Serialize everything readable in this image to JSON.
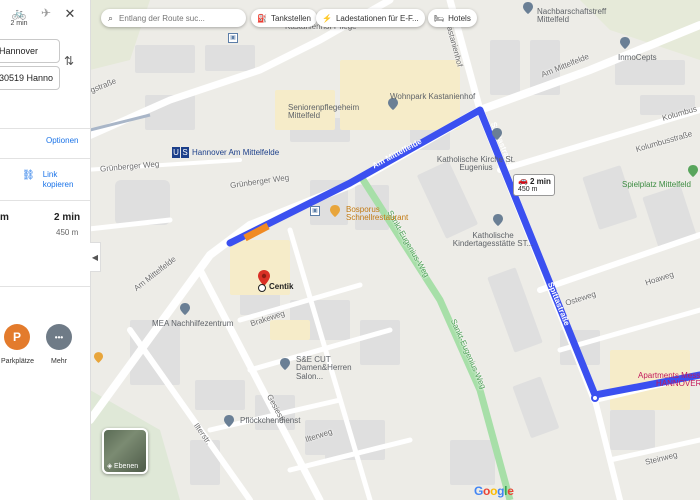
{
  "panel": {
    "modes": [
      {
        "icon": "bicycle-icon",
        "glyph": "🚲",
        "caption": "2 min"
      },
      {
        "icon": "airplane-icon",
        "glyph": "✈",
        "caption": ""
      },
      {
        "icon": "close-icon",
        "glyph": "✕",
        "caption": ""
      }
    ],
    "origin_value": "Hannover",
    "destination_value": "30519 Hanno",
    "options_label": "Optionen",
    "link_label": "Link kopieren",
    "route_duration": "2 min",
    "route_duration_left": "m",
    "route_distance": "450 m",
    "nearby": [
      {
        "icon": "parking-icon",
        "glyph": "P",
        "label": "Parkplätze",
        "color": "#e37b2c"
      },
      {
        "icon": "more-icon",
        "glyph": "•••",
        "label": "Mehr",
        "color": "#6f7b87"
      }
    ]
  },
  "map_controls": {
    "search_placeholder": "Entlang der Route suc...",
    "chips": [
      {
        "icon": "gas-station-icon",
        "glyph": "⛽",
        "label": "Tankstellen"
      },
      {
        "icon": "ev-charging-icon",
        "glyph": "⚡",
        "label": "Ladestationen für E-F..."
      },
      {
        "icon": "hotel-icon",
        "glyph": "🛏",
        "label": "Hotels"
      }
    ],
    "callout_duration": "2 min",
    "callout_distance": "450 m",
    "layers_label": "Ebenen",
    "attribution": "Google"
  },
  "map": {
    "route_color": "#3b50f0",
    "streets": [
      {
        "text": "Am Mittelfelde",
        "name": "street-am-mittelfelde-main"
      },
      {
        "text": "Am Mittelfelde",
        "name": "street-am-mittelfelde-ne"
      },
      {
        "text": "Am Mittelfelde",
        "name": "street-am-mittelfelde-sw"
      },
      {
        "text": "Spittastraße",
        "name": "street-spittastrasse-n"
      },
      {
        "text": "Spittastraße",
        "name": "street-spittastrasse-s"
      },
      {
        "text": "Kolumbusstraße",
        "name": "street-kolumbusstrasse"
      },
      {
        "text": "Kolumbus",
        "name": "street-kolumbus"
      },
      {
        "text": "Grünberger Weg",
        "name": "street-gruenberger-weg-1"
      },
      {
        "text": "Grünberger Weg",
        "name": "street-gruenberger-weg-2"
      },
      {
        "text": "Sankt-Eugenius-Weg",
        "name": "street-sankt-eugenius-weg-1"
      },
      {
        "text": "Sankt-Eugenius-Weg",
        "name": "street-sankt-eugenius-weg-2"
      },
      {
        "text": "Kastanienhof",
        "name": "street-kastanienhof"
      },
      {
        "text": "Osteweg",
        "name": "street-osteweg"
      },
      {
        "text": "Hoaweg",
        "name": "street-hoaweg"
      },
      {
        "text": "Brakeweg",
        "name": "street-brakeweg"
      },
      {
        "text": "Ilterweg",
        "name": "street-ilterweg"
      },
      {
        "text": "Gesiestr.",
        "name": "street-gesiestr"
      },
      {
        "text": "Steinweg",
        "name": "street-steinweg"
      },
      {
        "text": "gstraße",
        "name": "street-gstrasse"
      },
      {
        "text": "Ilterstr.",
        "name": "street-ilterstr"
      },
      {
        "text": "Kastanienhof Pflege",
        "name": "street-kastanienhof-pflege"
      }
    ],
    "pois": [
      {
        "text": "Nachbarschaftstreff Mittelfeld",
        "name": "poi-nachbarschaftstreff"
      },
      {
        "text": "InmoCepts",
        "name": "poi-inmocepts"
      },
      {
        "text": "Seniorenpflegeheim Mittelfeld",
        "name": "poi-seniorenpflegeheim"
      },
      {
        "text": "Wohnpark Kastanienhof",
        "name": "poi-wohnpark"
      },
      {
        "text": "Hannover Am Mittelfelde",
        "name": "poi-station"
      },
      {
        "text": "Katholische Kirche St. Eugenius",
        "name": "poi-kirche"
      },
      {
        "text": "Spielplatz Mittelfeld",
        "name": "poi-spielplatz"
      },
      {
        "text": "Bosporus Schnellrestaurant",
        "name": "poi-bosporus"
      },
      {
        "text": "Katholische Kindertagesstätte ST...",
        "name": "poi-kita"
      },
      {
        "text": "Centik",
        "name": "poi-centik"
      },
      {
        "text": "MEA Nachhilfezentrum",
        "name": "poi-mea"
      },
      {
        "text": "S&E CUT Damen&Herren Salon...",
        "name": "poi-se-cut"
      },
      {
        "text": "Pflöckchendienst",
        "name": "poi-pfloeckchendienst"
      },
      {
        "text": "Apartments Messe",
        "name": "poi-apartments"
      },
      {
        "text": "HANNOVER",
        "name": "poi-hannover-sign"
      }
    ]
  }
}
